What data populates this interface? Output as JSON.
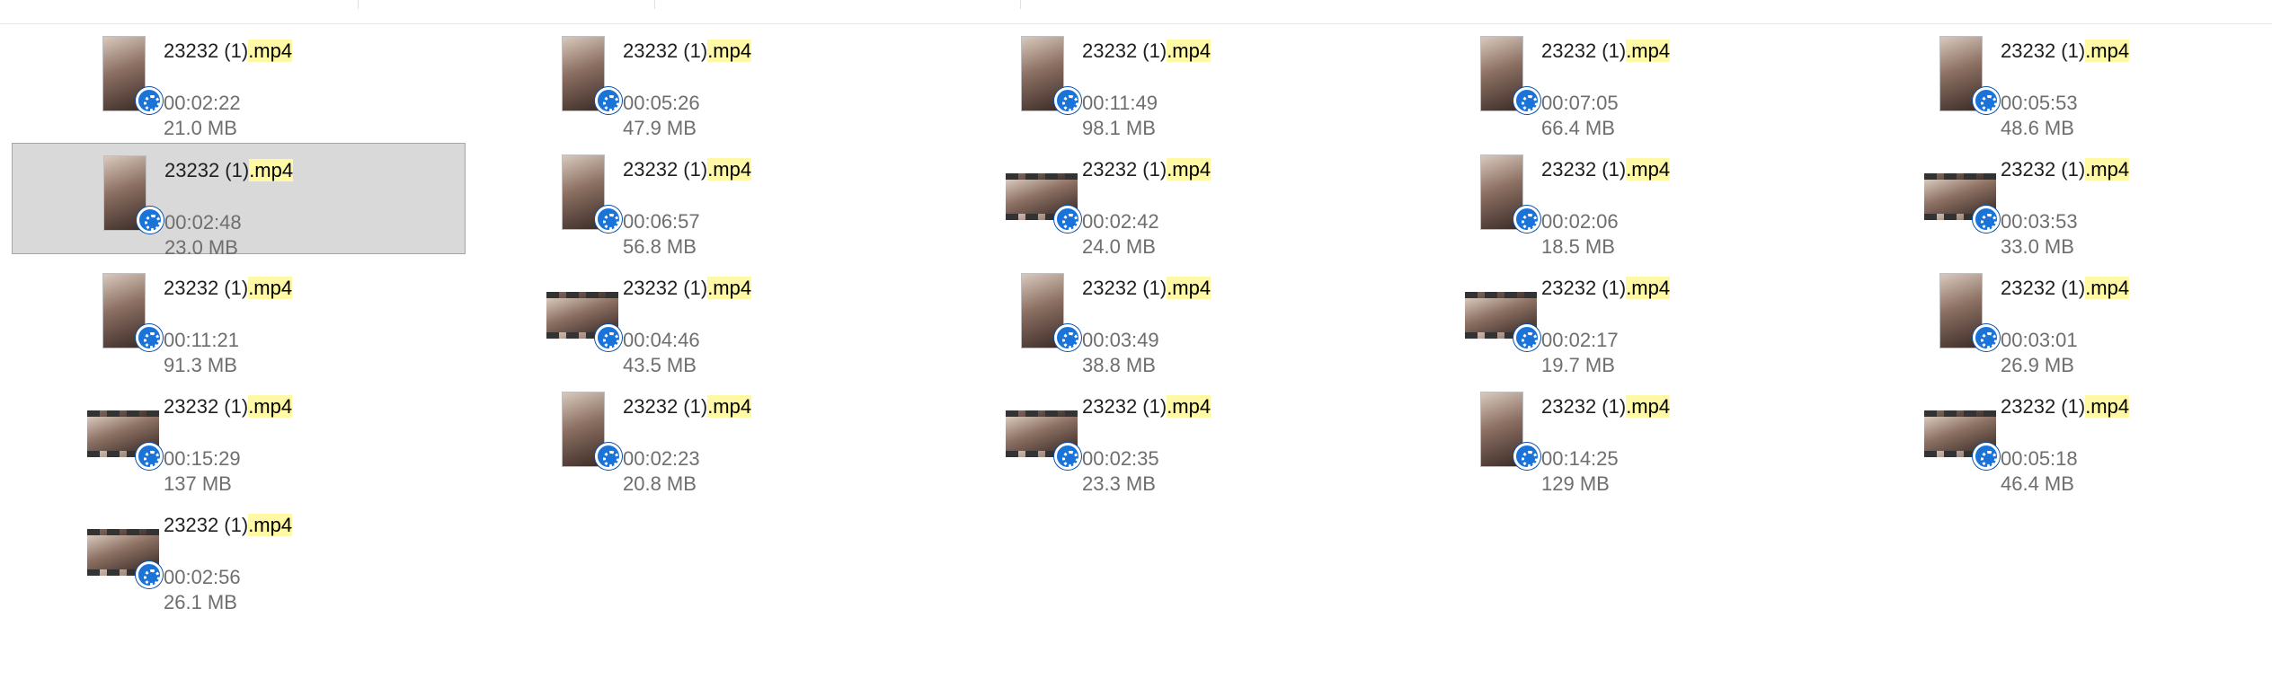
{
  "files": [
    {
      "base": "23232 (1)",
      "ext": ".mp4",
      "duration": "00:02:22",
      "size": "21.0 MB",
      "thumb": "portrait",
      "selected": false
    },
    {
      "base": "23232 (1)",
      "ext": ".mp4",
      "duration": "00:05:26",
      "size": "47.9 MB",
      "thumb": "portrait",
      "selected": false
    },
    {
      "base": "23232 (1)",
      "ext": ".mp4",
      "duration": "00:11:49",
      "size": "98.1 MB",
      "thumb": "portrait",
      "selected": false
    },
    {
      "base": "23232 (1)",
      "ext": ".mp4",
      "duration": "00:07:05",
      "size": "66.4 MB",
      "thumb": "portrait",
      "selected": false
    },
    {
      "base": "23232 (1)",
      "ext": ".mp4",
      "duration": "00:05:53",
      "size": "48.6 MB",
      "thumb": "portrait",
      "selected": false
    },
    {
      "base": "23232 (1)",
      "ext": ".mp4",
      "duration": "00:02:48",
      "size": "23.0 MB",
      "thumb": "portrait",
      "selected": true
    },
    {
      "base": "23232 (1)",
      "ext": ".mp4",
      "duration": "00:06:57",
      "size": "56.8 MB",
      "thumb": "portrait",
      "selected": false
    },
    {
      "base": "23232 (1)",
      "ext": ".mp4",
      "duration": "00:02:42",
      "size": "24.0 MB",
      "thumb": "landscape",
      "selected": false
    },
    {
      "base": "23232 (1)",
      "ext": ".mp4",
      "duration": "00:02:06",
      "size": "18.5 MB",
      "thumb": "portrait",
      "selected": false
    },
    {
      "base": "23232 (1)",
      "ext": ".mp4",
      "duration": "00:03:53",
      "size": "33.0 MB",
      "thumb": "landscape",
      "selected": false
    },
    {
      "base": "23232 (1)",
      "ext": ".mp4",
      "duration": "00:11:21",
      "size": "91.3 MB",
      "thumb": "portrait",
      "selected": false
    },
    {
      "base": "23232 (1)",
      "ext": ".mp4",
      "duration": "00:04:46",
      "size": "43.5 MB",
      "thumb": "landscape",
      "selected": false
    },
    {
      "base": "23232 (1)",
      "ext": ".mp4",
      "duration": "00:03:49",
      "size": "38.8 MB",
      "thumb": "portrait",
      "selected": false
    },
    {
      "base": "23232 (1)",
      "ext": ".mp4",
      "duration": "00:02:17",
      "size": "19.7 MB",
      "thumb": "landscape",
      "selected": false
    },
    {
      "base": "23232 (1)",
      "ext": ".mp4",
      "duration": "00:03:01",
      "size": "26.9 MB",
      "thumb": "portrait",
      "selected": false
    },
    {
      "base": "23232 (1)",
      "ext": ".mp4",
      "duration": "00:15:29",
      "size": "137 MB",
      "thumb": "landscape",
      "selected": false
    },
    {
      "base": "23232 (1)",
      "ext": ".mp4",
      "duration": "00:02:23",
      "size": "20.8 MB",
      "thumb": "portrait",
      "selected": false
    },
    {
      "base": "23232 (1)",
      "ext": ".mp4",
      "duration": "00:02:35",
      "size": "23.3 MB",
      "thumb": "landscape",
      "selected": false
    },
    {
      "base": "23232 (1)",
      "ext": ".mp4",
      "duration": "00:14:25",
      "size": "129 MB",
      "thumb": "portrait",
      "selected": false
    },
    {
      "base": "23232 (1)",
      "ext": ".mp4",
      "duration": "00:05:18",
      "size": "46.4 MB",
      "thumb": "landscape",
      "selected": false
    },
    {
      "base": "23232 (1)",
      "ext": ".mp4",
      "duration": "00:02:56",
      "size": "26.1 MB",
      "thumb": "landscape",
      "selected": false
    }
  ],
  "icons": {
    "thumbnail": "video-thumbnail-icon",
    "badge": "media-player-badge-icon"
  },
  "colors": {
    "selection_bg": "#d9d9d9",
    "highlight": "#fff9a5",
    "badge": "#1a73d9"
  }
}
